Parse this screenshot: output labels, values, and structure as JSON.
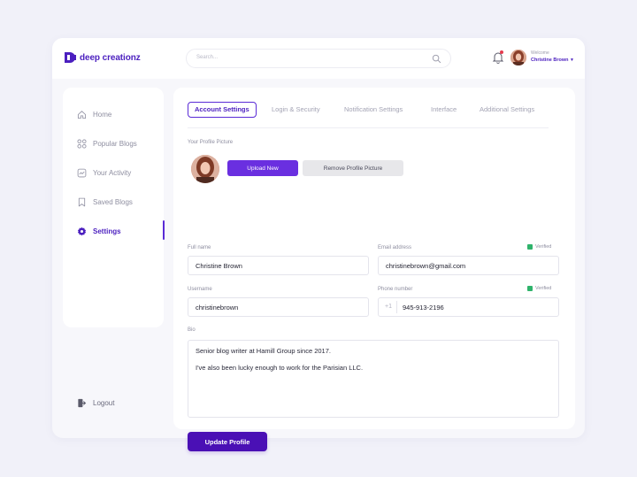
{
  "brand": {
    "name": "deep creationz",
    "color": "#4b1fbf"
  },
  "search": {
    "placeholder": "Search..."
  },
  "user": {
    "welcome_label": "Welcome",
    "name": "Christine Brown"
  },
  "sidebar": {
    "items": [
      {
        "label": "Home",
        "icon": "home-icon"
      },
      {
        "label": "Popular Blogs",
        "icon": "grid-icon"
      },
      {
        "label": "Your Activity",
        "icon": "activity-icon"
      },
      {
        "label": "Saved Blogs",
        "icon": "bookmark-icon"
      },
      {
        "label": "Settings",
        "icon": "gear-icon",
        "active": true
      }
    ],
    "logout_label": "Logout"
  },
  "tabs": [
    {
      "label": "Account Settings",
      "active": true
    },
    {
      "label": "Login & Security"
    },
    {
      "label": "Notification Settings"
    },
    {
      "label": "Interface"
    },
    {
      "label": "Additional Settings"
    }
  ],
  "profile": {
    "picture_label": "Your Profile Picture",
    "upload_label": "Upload New",
    "remove_label": "Remove Profile Picture"
  },
  "form": {
    "full_name_label": "Full name",
    "full_name": "Christine Brown",
    "email_label": "Email address",
    "email": "christinebrown@gmail.com",
    "email_status": "Verified",
    "username_label": "Username",
    "username": "christinebrown",
    "phone_label": "Phone number",
    "phone_prefix": "+1",
    "phone": "945-913-2196",
    "phone_status": "Verified",
    "bio_label": "Bio",
    "bio_line_1": "Senior blog writer at Hamill Group since 2017.",
    "bio_line_2": "I've also been lucky enough to work for the Parisian LLC.",
    "update_label": "Update Profile"
  },
  "colors": {
    "accent": "#6a2fe0",
    "accent_dark": "#4a10b5",
    "verified": "#2fb36b"
  }
}
